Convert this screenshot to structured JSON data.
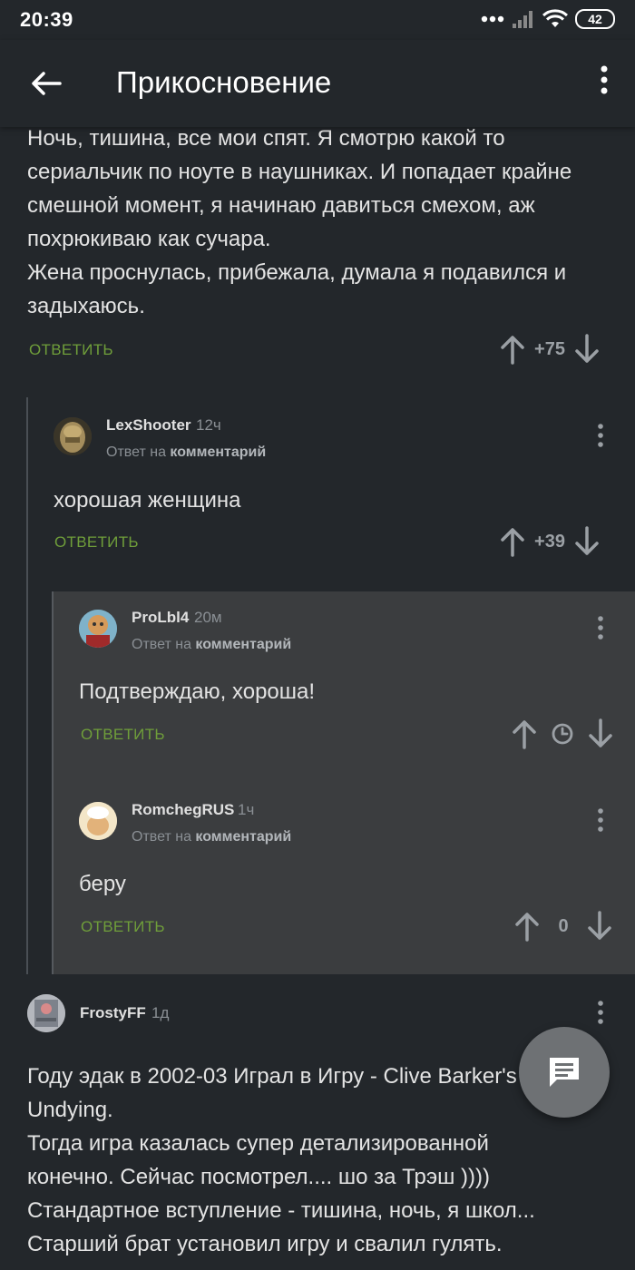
{
  "status_bar": {
    "time": "20:39",
    "battery": "42",
    "icons": [
      "dots-icon",
      "signal-icon",
      "wifi-icon",
      "battery-icon"
    ]
  },
  "app_bar": {
    "title": "Прикосновение",
    "back_icon": "arrow-left-icon",
    "menu_icon": "kebab-icon"
  },
  "top_comment": {
    "text": "Ночь, тишина, все мои спят. Я смотрю какой то\nсериальчик по ноуте в наушниках. И попадает крайне\nсмешной момент, я начинаю давиться смехом, аж\nпохрюкиваю как сучара.\nЖена проснулась, прибежала, думала я подавился и\nзадыхаюсь.",
    "reply_label": "ОТВЕТИТЬ",
    "score": "+75"
  },
  "comments": [
    {
      "author": "LexShooter",
      "time": "12ч",
      "reply_to_prefix": "Ответ на",
      "reply_to_target": "комментарий",
      "text": "хорошая женщина",
      "reply_label": "ОТВЕТИТЬ",
      "score": "+39"
    },
    {
      "author": "ProLbl4",
      "time": "20м",
      "reply_to_prefix": "Ответ на",
      "reply_to_target": "комментарий",
      "text": "Подтверждаю, хороша!",
      "reply_label": "ОТВЕТИТЬ",
      "score_icon": "clock-icon"
    },
    {
      "author": "RomchegRUS",
      "time": "1ч",
      "reply_to_prefix": "Ответ на",
      "reply_to_target": "комментарий",
      "text": "беру",
      "reply_label": "ОТВЕТИТЬ",
      "score": "0"
    },
    {
      "author": "FrostyFF",
      "time": "1д",
      "text": "Году эдак в 2002-03 Играл в Игру - Clive Barker's\nUndying.\nТогда игра казалась супер детализированной\nконечно. Сейчас посмотрел.... шо за Трэш ))))\nСтандартное вступление - тишина, ночь, я школ...\nСтарший брат установил игру и свалил гулять."
    }
  ],
  "fab": {
    "icon": "comment-icon"
  },
  "colors": {
    "background": "#23272b",
    "nested_background": "#3b3d3f",
    "reply_green": "#6f9e3a",
    "muted_text": "#8a8f94"
  }
}
